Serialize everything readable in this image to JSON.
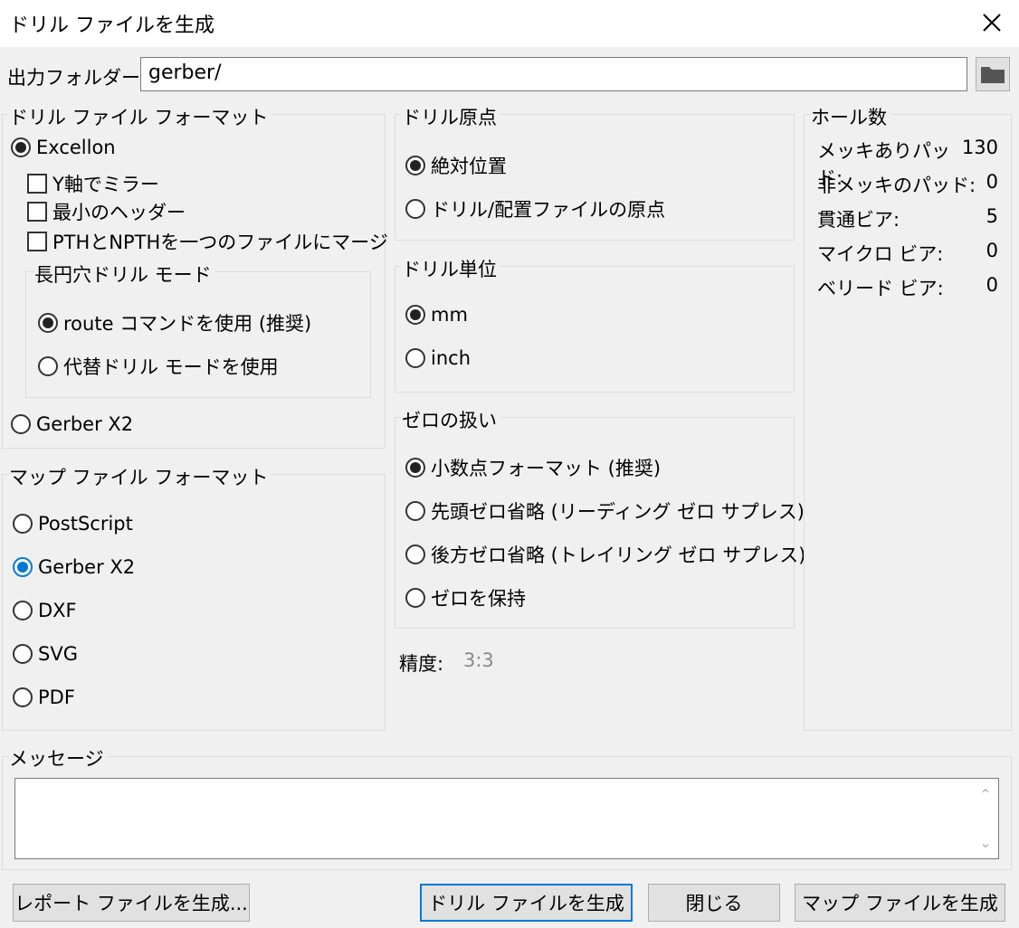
{
  "window": {
    "title": "ドリル ファイルを生成"
  },
  "output": {
    "label": "出力フォルダー:",
    "value": "gerber/"
  },
  "drill_format": {
    "title": "ドリル ファイル フォーマット",
    "excellon": "Excellon",
    "mirror_y": "Y軸でミラー",
    "min_header": "最小のヘッダー",
    "merge_pth": "PTHとNPTHを一つのファイルにマージ",
    "oval_mode": {
      "title": "長円穴ドリル モード",
      "route": "route コマンドを使用 (推奨)",
      "alternate": "代替ドリル モードを使用"
    },
    "gerber_x2": "Gerber X2"
  },
  "map_format": {
    "title": "マップ ファイル フォーマット",
    "options": [
      "PostScript",
      "Gerber X2",
      "DXF",
      "SVG",
      "PDF"
    ],
    "selected": "Gerber X2"
  },
  "drill_origin": {
    "title": "ドリル原点",
    "options": [
      "絶対位置",
      "ドリル/配置ファイルの原点"
    ]
  },
  "drill_units": {
    "title": "ドリル単位",
    "options": [
      "mm",
      "inch"
    ]
  },
  "zeros": {
    "title": "ゼロの扱い",
    "options": [
      "小数点フォーマット (推奨)",
      "先頭ゼロ省略 (リーディング ゼロ サプレス)",
      "後方ゼロ省略 (トレイリング ゼロ サプレス)",
      "ゼロを保持"
    ]
  },
  "precision": {
    "label": "精度:",
    "value": "3:3"
  },
  "hole_counts": {
    "title": "ホール数",
    "rows": [
      {
        "label": "メッキありパッド:",
        "value": "130"
      },
      {
        "label": "非メッキのパッド:",
        "value": "0"
      },
      {
        "label": "貫通ビア:",
        "value": "5"
      },
      {
        "label": "マイクロ ビア:",
        "value": "0"
      },
      {
        "label": "ベリード ビア:",
        "value": "0"
      }
    ]
  },
  "messages": {
    "title": "メッセージ"
  },
  "buttons": {
    "report": "レポート ファイルを生成...",
    "generate_drill": "ドリル ファイルを生成",
    "close": "閉じる",
    "generate_map": "マップ ファイルを生成"
  },
  "colors": {
    "accent": "#0078d7"
  }
}
